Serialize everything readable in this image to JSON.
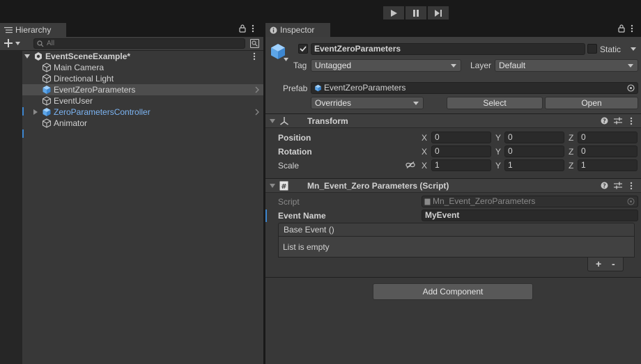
{
  "toolbar": {
    "play_icon": "play-icon",
    "pause_icon": "pause-icon",
    "step_icon": "step-icon"
  },
  "hierarchy": {
    "tab_label": "Hierarchy",
    "search_placeholder": "All",
    "scene_name": "EventSceneExample*",
    "items": [
      {
        "label": "Main Camera",
        "selected": false,
        "expandable": false,
        "color": "#d2d2d2"
      },
      {
        "label": "Directional Light",
        "selected": false,
        "expandable": false,
        "color": "#d2d2d2"
      },
      {
        "label": "EventZeroParameters",
        "selected": true,
        "expandable": false,
        "color": "#d2d2d2",
        "prefab": true
      },
      {
        "label": "EventUser",
        "selected": false,
        "expandable": false,
        "color": "#d2d2d2"
      },
      {
        "label": "ZeroParametersController",
        "selected": false,
        "expandable": true,
        "color": "#7cb4f2",
        "prefab": true
      },
      {
        "label": "Animator",
        "selected": false,
        "expandable": false,
        "color": "#d2d2d2"
      }
    ]
  },
  "inspector": {
    "tab_label": "Inspector",
    "object_name": "EventZeroParameters",
    "static_label": "Static",
    "tag_label": "Tag",
    "tag_value": "Untagged",
    "layer_label": "Layer",
    "layer_value": "Default",
    "prefab_label": "Prefab",
    "prefab_value": "EventZeroParameters",
    "overrides_value": "Overrides",
    "select_label": "Select",
    "open_label": "Open",
    "transform": {
      "title": "Transform",
      "position_label": "Position",
      "rotation_label": "Rotation",
      "scale_label": "Scale",
      "axis_x": "X",
      "axis_y": "Y",
      "axis_z": "Z",
      "position": {
        "x": "0",
        "y": "0",
        "z": "0"
      },
      "rotation": {
        "x": "0",
        "y": "0",
        "z": "0"
      },
      "scale": {
        "x": "1",
        "y": "1",
        "z": "1"
      }
    },
    "script_component": {
      "title": "Mn_Event_Zero Parameters (Script)",
      "script_label": "Script",
      "script_value": "Mn_Event_ZeroParameters",
      "event_name_label": "Event Name",
      "event_name_value": "MyEvent",
      "event_header": "Base Event ()",
      "list_empty": "List is empty",
      "plus": "+",
      "minus": "-"
    },
    "add_component_label": "Add Component"
  },
  "colors": {
    "accent_blue": "#7cb4f2",
    "selection": "#4d4d4d",
    "panel": "#383838"
  }
}
